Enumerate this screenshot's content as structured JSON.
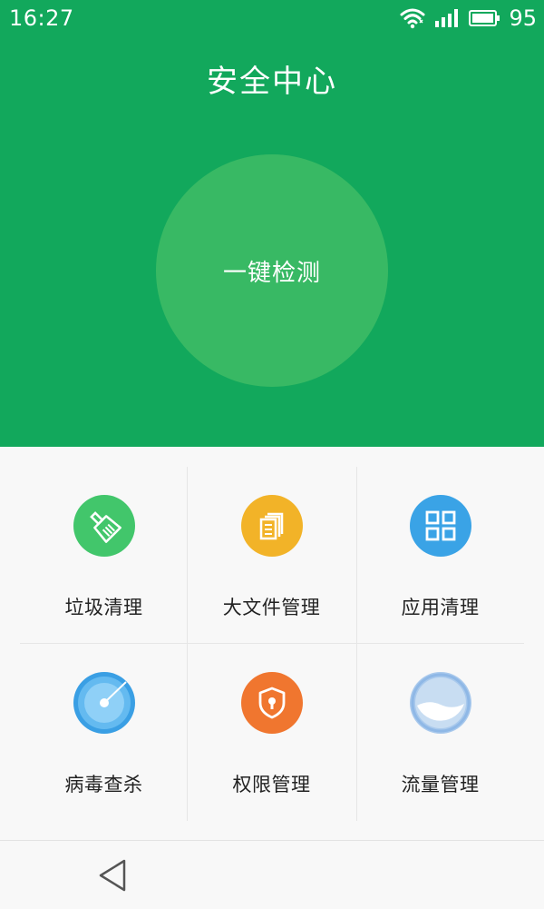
{
  "status_bar": {
    "time": "16:27",
    "battery_percent": "95",
    "icons": [
      "wifi-icon",
      "signal-icon",
      "battery-icon"
    ]
  },
  "header": {
    "title": "安全中心"
  },
  "scan": {
    "button_label": "一键检测"
  },
  "features": [
    {
      "label": "垃圾清理",
      "icon": "broom-icon",
      "color": "#42c66b"
    },
    {
      "label": "大文件管理",
      "icon": "files-icon",
      "color": "#f2b328"
    },
    {
      "label": "应用清理",
      "icon": "app-grid-icon",
      "color": "#3aa3e6"
    },
    {
      "label": "病毒查杀",
      "icon": "radar-icon",
      "color": "#3a9fe4"
    },
    {
      "label": "权限管理",
      "icon": "shield-lock-icon",
      "color": "#f0762f"
    },
    {
      "label": "流量管理",
      "icon": "data-traffic-icon",
      "color": "#a9c9ec"
    }
  ],
  "nav_bar": {
    "icons": [
      "back-icon"
    ]
  },
  "colors": {
    "header_green": "#12a85c",
    "scan_circle": "#38b964"
  }
}
